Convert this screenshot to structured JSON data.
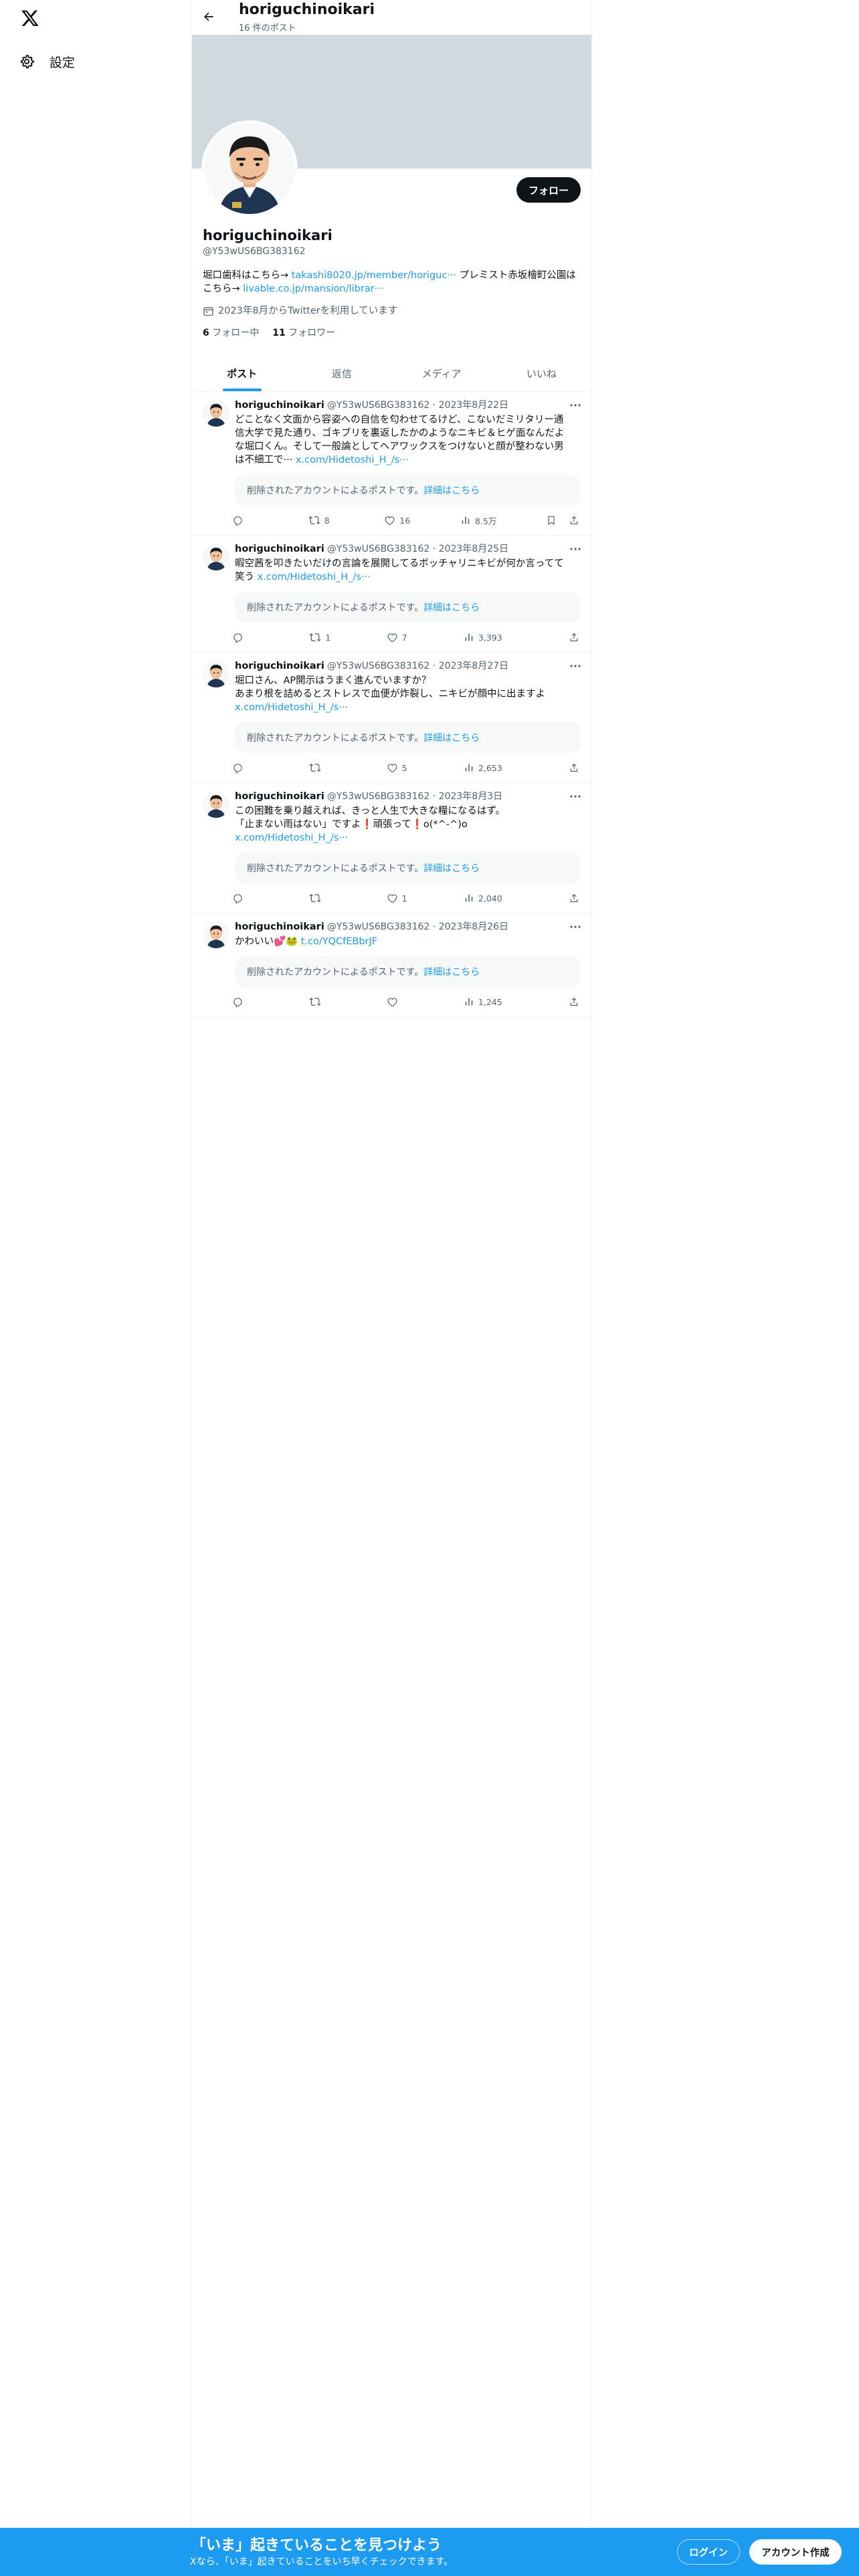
{
  "nav": {
    "settings_label": "設定"
  },
  "topbar": {
    "name": "horiguchinoikari",
    "post_count": "16 件のポスト"
  },
  "profile": {
    "name": "horiguchinoikari",
    "handle": "@Y53wUS6BG383162",
    "follow_label": "フォロー",
    "bio": {
      "line1_text": "堀口歯科はこちら→ ",
      "line1_link": "takashi8020.jp/member/horiguc···",
      "line1_text2": " プレミスト赤坂檜町公園は",
      "line2_text": "こちら→ ",
      "line2_link": "livable.co.jp/mansion/librar···"
    },
    "joined": "2023年8月からTwitterを利用しています",
    "following_count": "6",
    "following_label": "フォロー中",
    "followers_count": "11",
    "followers_label": "フォロワー"
  },
  "tabs": [
    {
      "label": "ポスト"
    },
    {
      "label": "返信"
    },
    {
      "label": "メディア"
    },
    {
      "label": "いいね"
    }
  ],
  "deleted_notice": {
    "text": "削除されたアカウントによるポストです。",
    "link": "詳細はこちら"
  },
  "posts": [
    {
      "name": "horiguchinoikari",
      "meta": "@Y53wUS6BG383162 · 2023年8月22日",
      "lines": [
        "どことなく文面から容姿への自信を匂わせてるけど、こないだミリタリー通",
        "信大学で見た通り、ゴキブリを裏返したかのようなニキビ＆ヒゲ面なんだよ",
        "な堀口くん。そして一般論としてヘアワックスをつけないと顔が整わない男"
      ],
      "last_text": "は不細工で··· ",
      "link": "x.com/Hidetoshi_H_/s···",
      "reply": "",
      "repost": "8",
      "like": "16",
      "views": "8.5万"
    },
    {
      "name": "horiguchinoikari",
      "meta": "@Y53wUS6BG383162 · 2023年8月25日",
      "lines": [
        "暇空茜を叩きたいだけの言論を展開してるボッチャリニキビが何か言ってて"
      ],
      "last_text": "笑う ",
      "link": "x.com/Hidetoshi_H_/s···",
      "reply": "",
      "repost": "1",
      "like": "7",
      "views": "3,393"
    },
    {
      "name": "horiguchinoikari",
      "meta": "@Y53wUS6BG383162 · 2023年8月27日",
      "lines": [
        "堀口さん、AP開示はうまく進んでいますか？",
        "あまり根を詰めるとストレスで血便が炸裂し、ニキビが顔中に出ますよ"
      ],
      "last_text": "",
      "link": "x.com/Hidetoshi_H_/s···",
      "reply": "",
      "repost": "",
      "like": "5",
      "views": "2,653"
    },
    {
      "name": "horiguchinoikari",
      "meta": "@Y53wUS6BG383162 · 2023年8月3日",
      "lines": [
        "この困難を乗り越えれば、きっと人生で大きな糧になるはず。",
        "「止まない雨はない」ですよ❗️頑張って❗️o(*^-^)o"
      ],
      "last_text": "",
      "link": "x.com/Hidetoshi_H_/s···",
      "reply": "",
      "repost": "",
      "like": "1",
      "views": "2,040"
    },
    {
      "name": "horiguchinoikari",
      "meta": "@Y53wUS6BG383162 · 2023年8月26日",
      "lines": [],
      "last_text": "かわいい💕🐸 ",
      "link": "t.co/YQCfEBbrJF",
      "reply": "",
      "repost": "",
      "like": "",
      "views": "1,245"
    }
  ],
  "bottom_bar": {
    "title": "「いま」起きていることを見つけよう",
    "subtitle": "Xなら、「いま」起きていることをいち早くチェックできます。",
    "login_label": "ログイン",
    "signup_label": "アカウント作成"
  },
  "colors": {
    "accent": "#1d9bf0",
    "text": "#0f1419",
    "muted": "#536471",
    "banner": "#cfd9de"
  }
}
